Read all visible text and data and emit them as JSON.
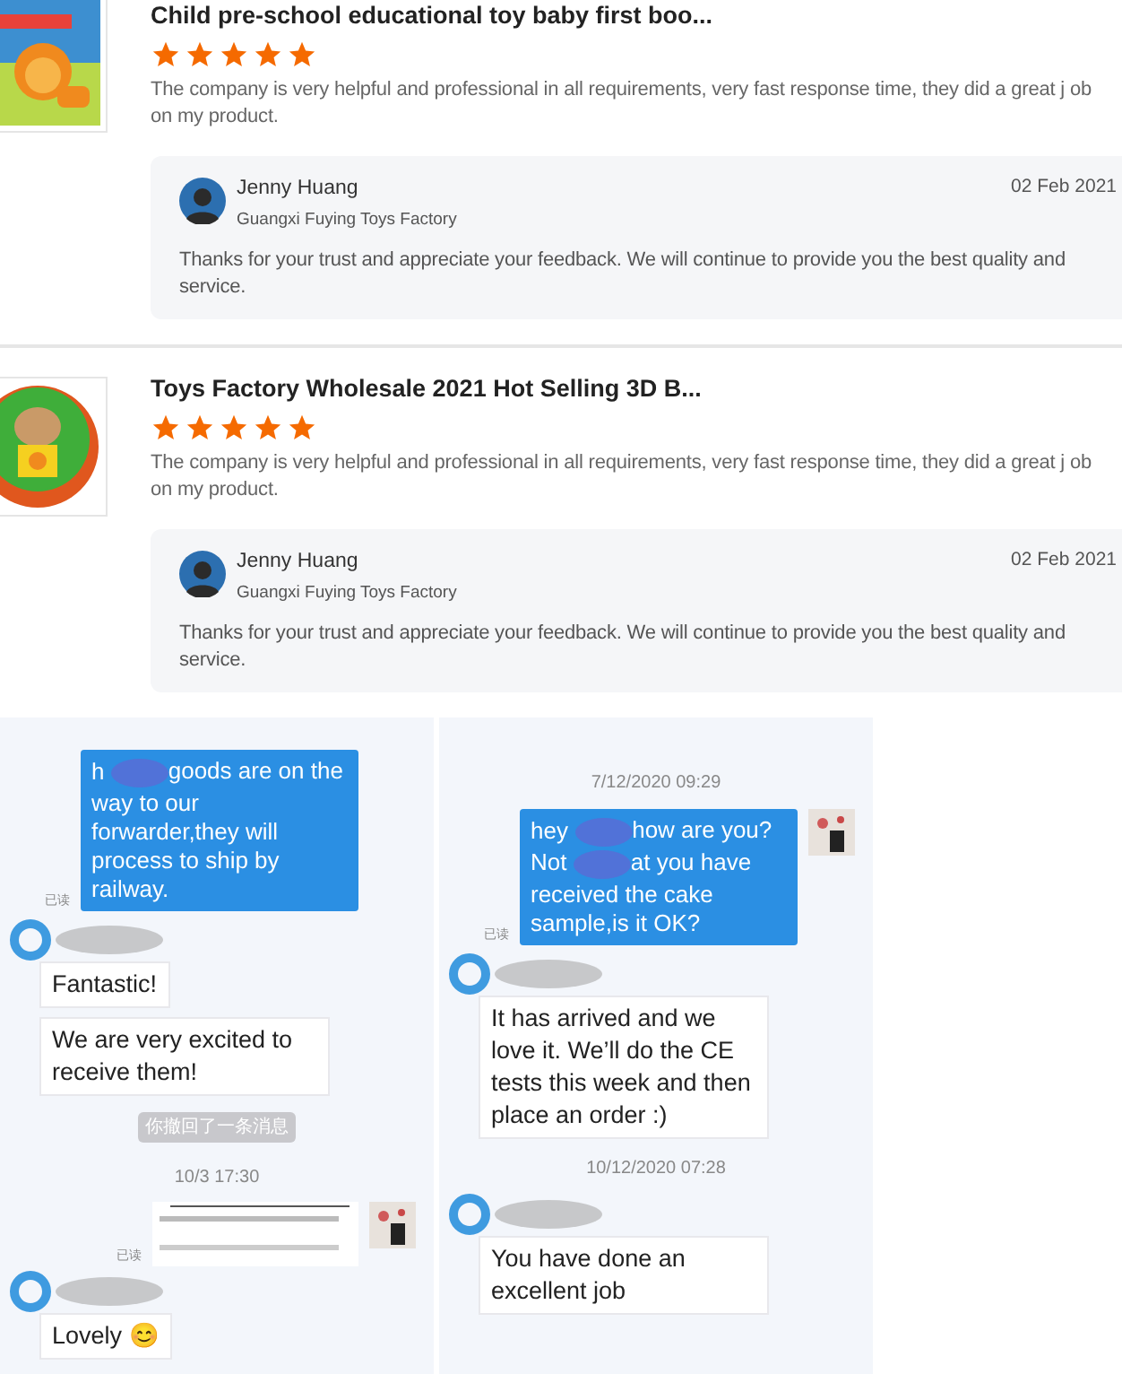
{
  "reviews": [
    {
      "product_title": "Child pre-school educational toy baby first boo...",
      "stars": 5,
      "comment": "The company is very helpful and professional in all requirements, very fast response time, they did a great j ob on my product.",
      "reply": {
        "name": "Jenny Huang",
        "company": "Guangxi Fuying Toys Factory",
        "date": "02 Feb 2021",
        "text": "Thanks for your trust and appreciate your feedback. We will continue to provide you the best quality and service."
      }
    },
    {
      "product_title": "Toys Factory Wholesale 2021 Hot Selling 3D B...",
      "stars": 5,
      "comment": "The company is very helpful and professional in all requirements, very fast response time, they did a great j ob on my product.",
      "reply": {
        "name": "Jenny Huang",
        "company": "Guangxi Fuying Toys Factory",
        "date": "02 Feb 2021",
        "text": "Thanks for your trust and appreciate your feedback. We will continue to provide you the best quality and service."
      }
    }
  ],
  "chats": [
    {
      "messages": [
        {
          "kind": "outgoing",
          "segments": [
            "h",
            "goods are on the way to our forwarder,they will process to ship by railway."
          ],
          "read": "已读",
          "avatar": false
        },
        {
          "kind": "incoming",
          "bubbles": [
            "Fantastic!",
            "We are very excited to receive them!"
          ]
        },
        {
          "kind": "notice",
          "text": "你撤回了一条消息"
        },
        {
          "kind": "timestamp",
          "text": "10/3 17:30"
        },
        {
          "read": "已读",
          "avatar": true
        },
        {
          "kind": "incoming",
          "bubbles": [
            "Lovely 😊"
          ]
        }
      ]
    },
    {
      "messages": [
        {
          "kind": "timestamp",
          "text": "7/12/2020 09:29"
        },
        {
          "kind": "outgoing",
          "segments": [
            "hey",
            "how are you?Not",
            "at you have received the cake sample,is it OK?"
          ],
          "read": "已读",
          "avatar": true
        },
        {
          "kind": "incoming",
          "bubbles": [
            "It has arrived and we love it. We’ll do the CE tests this week and then place an order :)"
          ]
        },
        {
          "kind": "timestamp",
          "text": "10/12/2020 07:28"
        },
        {
          "kind": "incoming",
          "bubbles": [
            "You have done an excellent job"
          ]
        }
      ]
    }
  ]
}
